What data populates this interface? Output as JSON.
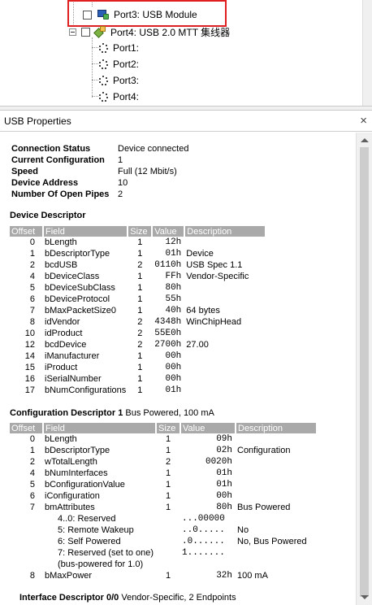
{
  "tree": {
    "selected_label": "Port3: USB Module",
    "hub_label": "Port4: USB 2.0 MTT 集线器",
    "ports": [
      "Port1:",
      "Port2:",
      "Port3:",
      "Port4:"
    ]
  },
  "panel": {
    "title": "USB Properties",
    "close": "×"
  },
  "summary": [
    {
      "key": "Connection Status",
      "value": "Device connected"
    },
    {
      "key": "Current Configuration",
      "value": "1"
    },
    {
      "key": "Speed",
      "value": "Full (12 Mbit/s)"
    },
    {
      "key": "Device Address",
      "value": "10"
    },
    {
      "key": "Number Of Open Pipes",
      "value": "2"
    }
  ],
  "device_descriptor": {
    "title": "Device Descriptor",
    "headers": [
      "Offset",
      "Field",
      "Size",
      "Value",
      "Description"
    ],
    "rows": [
      [
        "0",
        "bLength",
        "1",
        "12h",
        ""
      ],
      [
        "1",
        "bDescriptorType",
        "1",
        "01h",
        "Device"
      ],
      [
        "2",
        "bcdUSB",
        "2",
        "0110h",
        "USB Spec 1.1"
      ],
      [
        "4",
        "bDeviceClass",
        "1",
        "FFh",
        "Vendor-Specific"
      ],
      [
        "5",
        "bDeviceSubClass",
        "1",
        "80h",
        ""
      ],
      [
        "6",
        "bDeviceProtocol",
        "1",
        "55h",
        ""
      ],
      [
        "7",
        "bMaxPacketSize0",
        "1",
        "40h",
        "64 bytes"
      ],
      [
        "8",
        "idVendor",
        "2",
        "4348h",
        "WinChipHead"
      ],
      [
        "10",
        "idProduct",
        "2",
        "55E0h",
        ""
      ],
      [
        "12",
        "bcdDevice",
        "2",
        "2700h",
        "27.00"
      ],
      [
        "14",
        "iManufacturer",
        "1",
        "00h",
        ""
      ],
      [
        "15",
        "iProduct",
        "1",
        "00h",
        ""
      ],
      [
        "16",
        "iSerialNumber",
        "1",
        "00h",
        ""
      ],
      [
        "17",
        "bNumConfigurations",
        "1",
        "01h",
        ""
      ]
    ]
  },
  "config_descriptor": {
    "title": "Configuration Descriptor 1",
    "subtitle": "Bus Powered, 100 mA",
    "headers": [
      "Offset",
      "Field",
      "Size",
      "Value",
      "Description"
    ],
    "rows": [
      [
        "0",
        "bLength",
        "1",
        "09h",
        ""
      ],
      [
        "1",
        "bDescriptorType",
        "1",
        "02h",
        "Configuration"
      ],
      [
        "2",
        "wTotalLength",
        "2",
        "0020h",
        ""
      ],
      [
        "4",
        "bNumInterfaces",
        "1",
        "01h",
        ""
      ],
      [
        "5",
        "bConfigurationValue",
        "1",
        "01h",
        ""
      ],
      [
        "6",
        "iConfiguration",
        "1",
        "00h",
        ""
      ],
      [
        "7",
        "bmAttributes",
        "1",
        "80h",
        "Bus Powered"
      ]
    ],
    "bit_rows": [
      [
        "4..0: Reserved",
        "...00000",
        ""
      ],
      [
        "5: Remote Wakeup",
        "..0.....",
        "No"
      ],
      [
        "6: Self Powered",
        ".0......",
        "No, Bus Powered"
      ],
      [
        "7: Reserved (set to one)",
        "1.......",
        ""
      ],
      [
        "(bus-powered for 1.0)",
        "",
        ""
      ]
    ],
    "last_row": [
      "8",
      "bMaxPower",
      "1",
      "32h",
      "100 mA"
    ]
  },
  "interface_descriptor": {
    "title": "Interface Descriptor 0/0",
    "subtitle": "Vendor-Specific, 2 Endpoints"
  }
}
